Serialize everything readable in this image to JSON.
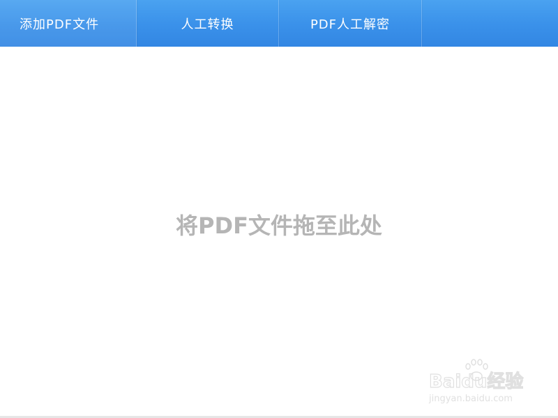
{
  "toolbar": {
    "tabs": [
      {
        "label": "添加PDF文件"
      },
      {
        "label": "人工转换"
      },
      {
        "label": "PDF人工解密"
      }
    ]
  },
  "drop_zone": {
    "hint": "将PDF文件拖至此处"
  },
  "watermark": {
    "brand": "Baidu经验",
    "url": "jingyan.baidu.com"
  },
  "colors": {
    "toolbar_blue": "#3b92ea",
    "hint_gray": "#b5b5b5"
  }
}
